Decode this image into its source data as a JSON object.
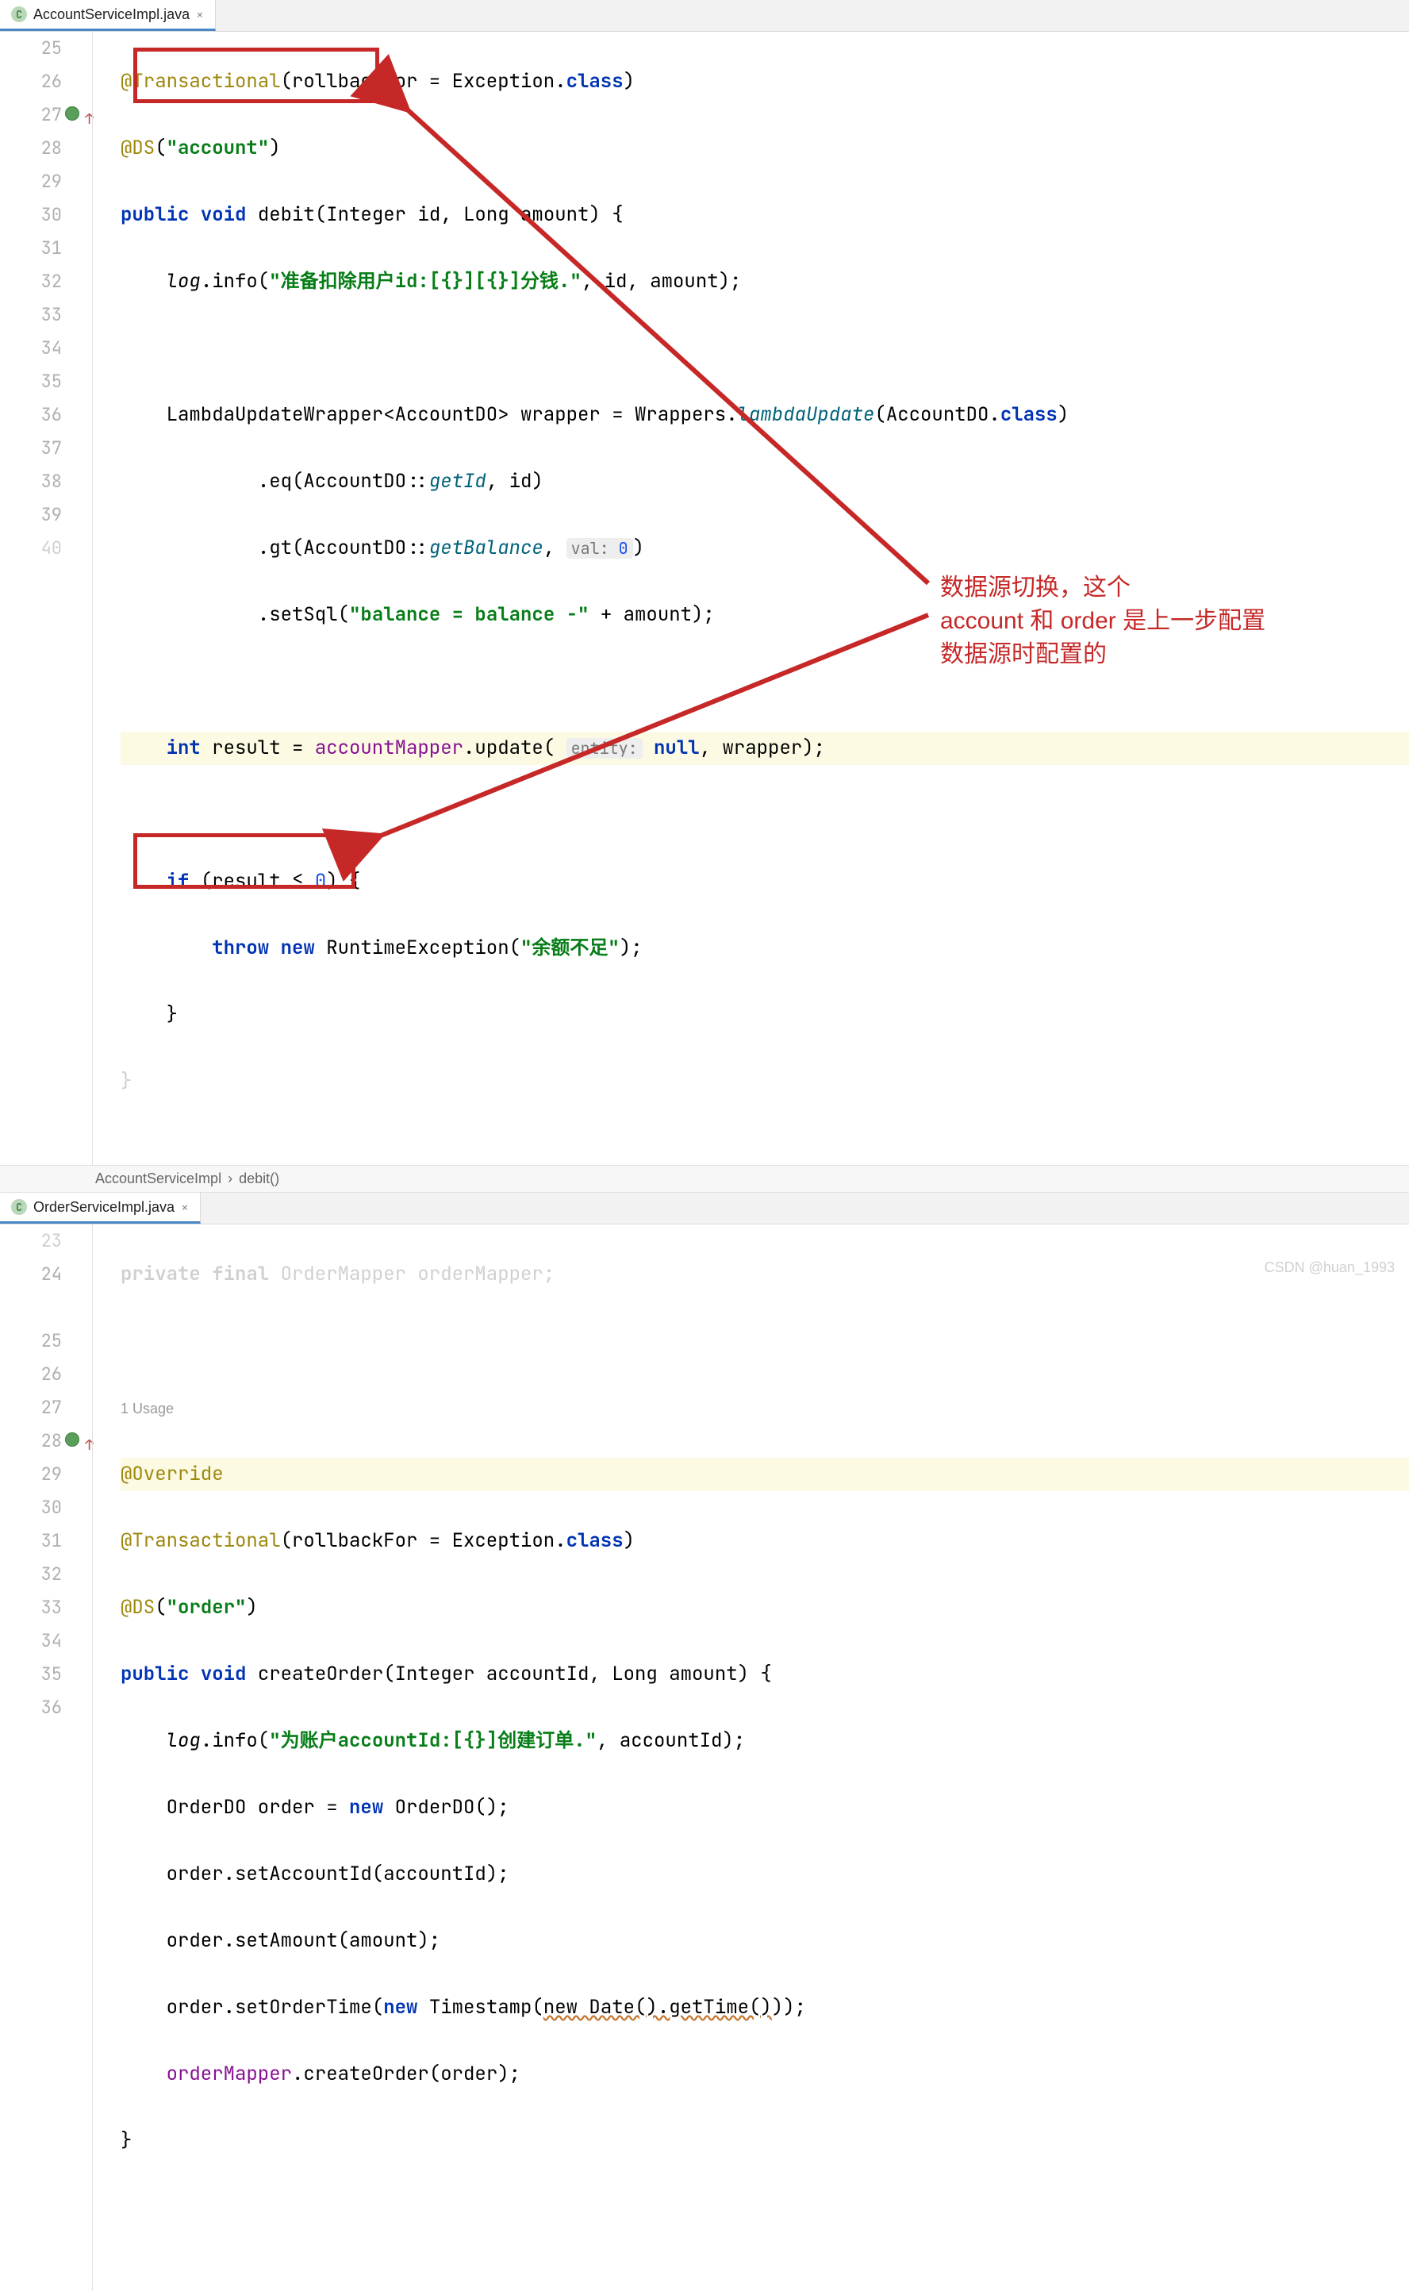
{
  "top_tab": {
    "icon": "C",
    "label": "AccountServiceImpl.java"
  },
  "top_breadcrumb": {
    "cls": "AccountServiceImpl",
    "method": "debit()"
  },
  "top_gutter_start": 25,
  "top_gutter_end": 40,
  "top_code": {
    "l25_ann": "@Transactional",
    "l25_rest": "(rollbackFor = Exception.",
    "l25_kw": "class",
    "l25_paren": ")",
    "l26_ann": "@DS",
    "l26_open": "(",
    "l26_str": "\"account\"",
    "l26_close": ")",
    "l27_pub": "public",
    "l27_void": "void",
    "l27_name": " debit(Integer id, Long amount) {",
    "l28_log": "log",
    "l28_info": ".info(",
    "l28_str": "\"准备扣除用户id:[{}][{}]分钱.\"",
    "l28_rest": ", id, amount);",
    "l30_a": "LambdaUpdateWrapper<AccountDO> wrapper = Wrappers.",
    "l30_m": "lambdaUpdate",
    "l30_b": "(AccountDO.",
    "l30_kw": "class",
    "l30_c": ")",
    "l31_a": ".eq(AccountDO::",
    "l31_m": "getId",
    "l31_b": ", id)",
    "l32_a": ".gt(AccountDO::",
    "l32_m": "getBalance",
    "l32_b": ", ",
    "l32_hint": "val:",
    "l32_num": "0",
    "l32_c": ")",
    "l33_a": ".setSql(",
    "l33_str": "\"balance = balance -\"",
    "l33_b": " + amount);",
    "l35_a": "int",
    "l35_b": " result = ",
    "l35_f": "accountMapper",
    "l35_c": ".update( ",
    "l35_hint": "entity:",
    "l35_kw": "null",
    "l35_d": ", wrapper);",
    "l37_a": "if",
    "l37_b": " (result ≤ ",
    "l37_num": "0",
    "l37_c": ") {",
    "l38_a": "throw",
    "l38_b": "new",
    "l38_c": " RuntimeException(",
    "l38_str": "\"余额不足\"",
    "l38_d": ");",
    "l39_a": "}"
  },
  "bot_tab": {
    "icon": "C",
    "label": "OrderServiceImpl.java"
  },
  "bot_gutter_start": 23,
  "bot_gutter_end": 36,
  "bot_code": {
    "l23_a": "private final",
    "l23_b": " OrderMapper ",
    "l23_f": "orderMapper",
    "l23_c": ";",
    "l24_usage": "1 Usage",
    "l25_ann": "@Override",
    "l26_ann": "@Transactional",
    "l26_rest": "(rollbackFor = Exception.",
    "l26_kw": "class",
    "l26_c": ")",
    "l27_ann": "@DS",
    "l27_open": "(",
    "l27_str": "\"order\"",
    "l27_close": ")",
    "l28_pub": "public",
    "l28_void": "void",
    "l28_name": " createOrder(Integer accountId, Long amount) {",
    "l29_log": "log",
    "l29_info": ".info(",
    "l29_str": "\"为账户accountId:[{}]创建订单.\"",
    "l29_rest": ", accountId);",
    "l30_a": "OrderDO order = ",
    "l30_kw": "new",
    "l30_b": " OrderDO();",
    "l31_a": "order.setAccountId(accountId);",
    "l32_a": "order.setAmount(amount);",
    "l33_a": "order.setOrderTime(",
    "l33_kw": "new",
    "l33_b": " Timestamp(",
    "l33_u": "new Date().getTime()",
    "l33_c": "));",
    "l34_f": "orderMapper",
    "l34_a": ".createOrder(order);",
    "l35_a": "}"
  },
  "annotation": {
    "line1": "数据源切换，这个",
    "line2": "account 和 order 是上一步配置",
    "line3": "数据源时配置的"
  },
  "watermark": "CSDN @huan_1993"
}
